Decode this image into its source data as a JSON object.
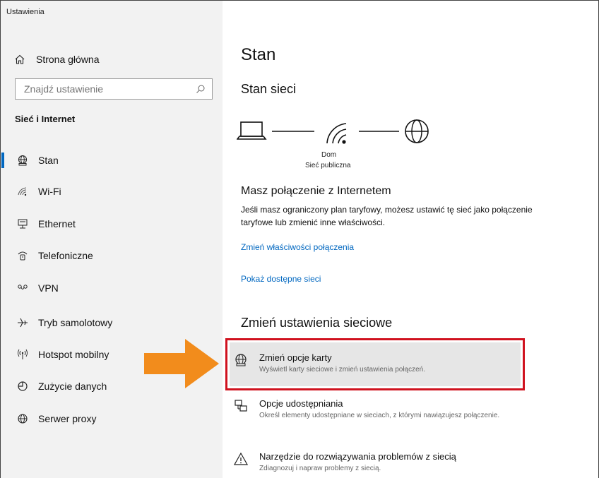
{
  "app": {
    "title": "Ustawienia"
  },
  "sidebar": {
    "home_label": "Strona główna",
    "search": {
      "placeholder": "Znajdź ustawienie"
    },
    "section_title": "Sieć i Internet",
    "items": [
      {
        "label": "Stan",
        "icon": "status-globe-icon",
        "active": true
      },
      {
        "label": "Wi-Fi",
        "icon": "wifi-icon",
        "active": false
      },
      {
        "label": "Ethernet",
        "icon": "ethernet-icon",
        "active": false
      },
      {
        "label": "Telefoniczne",
        "icon": "dialup-icon",
        "active": false
      },
      {
        "label": "VPN",
        "icon": "vpn-icon",
        "active": false
      },
      {
        "label": "Tryb samolotowy",
        "icon": "airplane-icon",
        "active": false
      },
      {
        "label": "Hotspot mobilny",
        "icon": "hotspot-icon",
        "active": false
      },
      {
        "label": "Zużycie danych",
        "icon": "data-usage-icon",
        "active": false
      },
      {
        "label": "Serwer proxy",
        "icon": "globe-icon",
        "active": false
      }
    ]
  },
  "main": {
    "title": "Stan",
    "network_status": "Stan sieci",
    "network_name": "Dom",
    "network_type": "Sieć publiczna",
    "connected_title": "Masz połączenie z Internetem",
    "connected_desc": "Jeśli masz ograniczony plan taryfowy, możesz ustawić tę sieć jako połączenie taryfowe lub zmienić inne właściwości.",
    "link_change_props": "Zmień właściwości połączenia",
    "link_show_networks": "Pokaż dostępne sieci",
    "change_settings_title": "Zmień ustawienia sieciowe",
    "options": [
      {
        "title": "Zmień opcje karty",
        "desc": "Wyświetl karty sieciowe i zmień ustawienia połączeń.",
        "icon": "adapter-options-icon"
      },
      {
        "title": "Opcje udostępniania",
        "desc": "Określ elementy udostępniane w sieciach, z którymi nawiązujesz połączenie.",
        "icon": "sharing-options-icon"
      },
      {
        "title": "Narzędzie do rozwiązywania problemów z siecią",
        "desc": "Zdiagnozuj i napraw problemy z siecią.",
        "icon": "warning-icon"
      }
    ]
  },
  "colors": {
    "accent": "#0067c0",
    "highlight_border": "#d0121f",
    "arrow": "#f28c1c"
  }
}
